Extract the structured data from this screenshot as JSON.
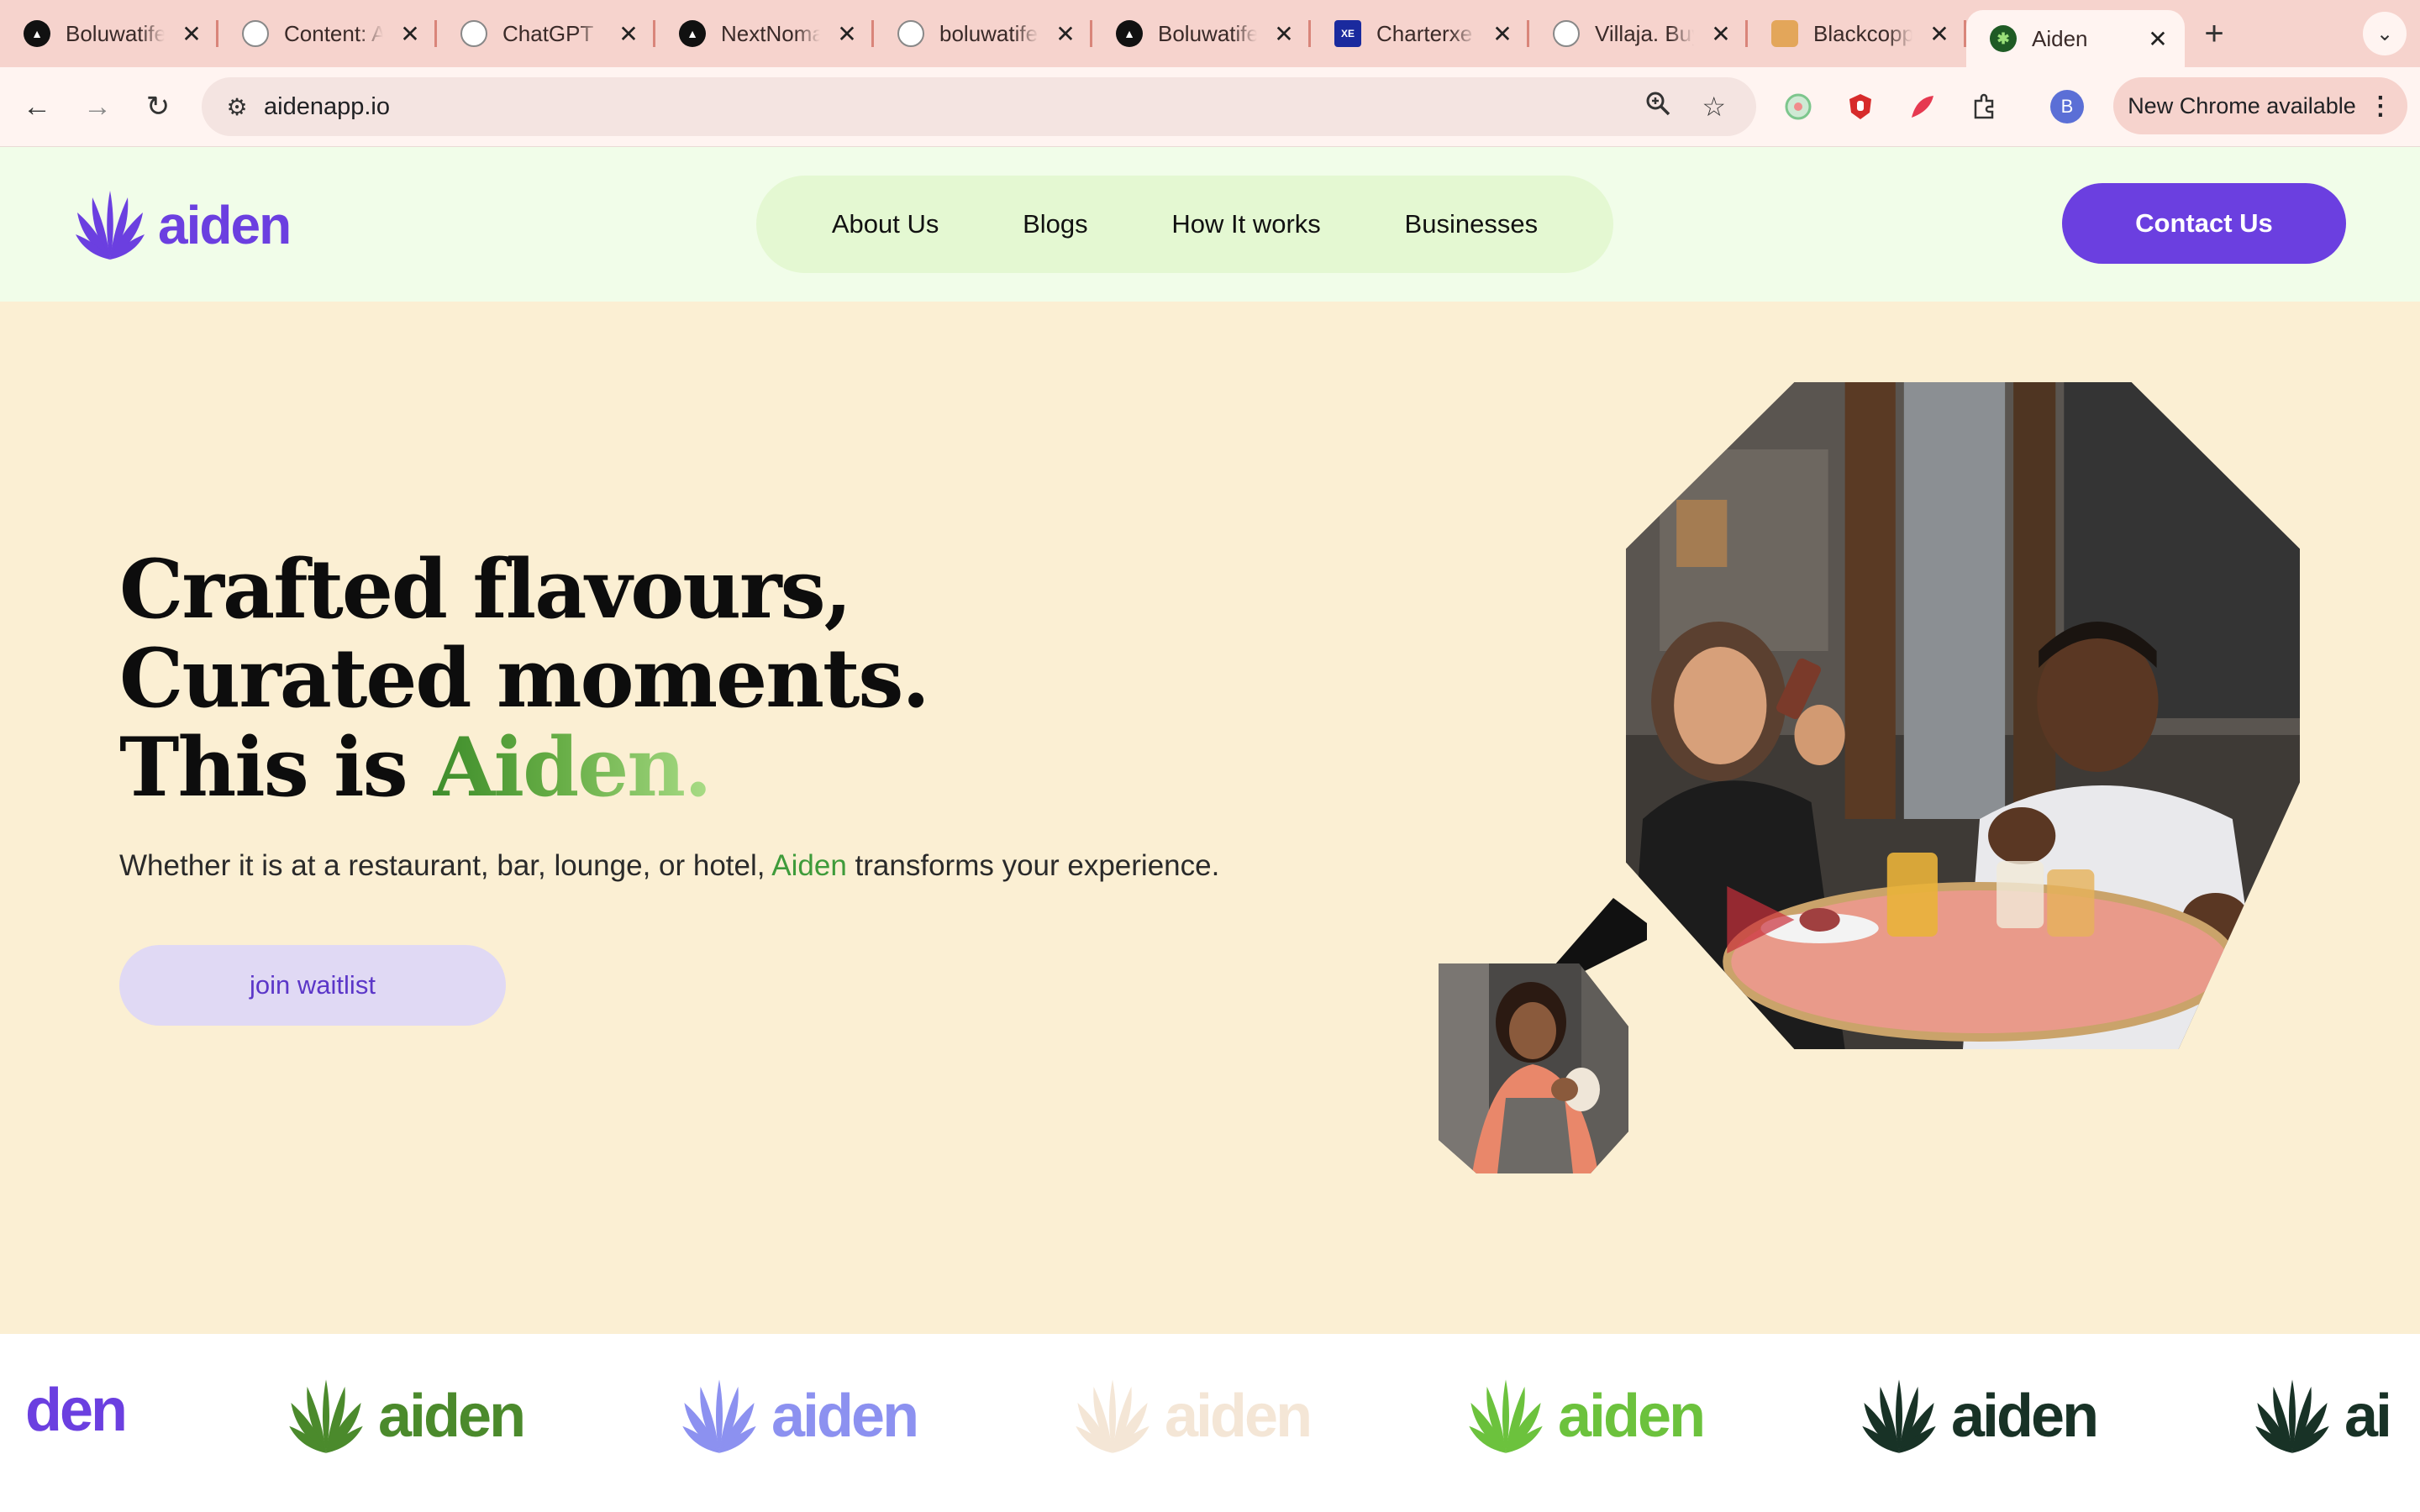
{
  "browser": {
    "tabs": [
      {
        "title": "Boluwatife",
        "favicon": "triangle-logo",
        "color": "#111111"
      },
      {
        "title": "Content: A",
        "favicon": "google-logo",
        "color": "#ffffff"
      },
      {
        "title": "ChatGPT",
        "favicon": "chatgpt-logo",
        "color": "#ffffff"
      },
      {
        "title": "NextNoma",
        "favicon": "triangle-logo",
        "color": "#111111"
      },
      {
        "title": "boluwatife",
        "favicon": "github-logo",
        "color": "#ffffff"
      },
      {
        "title": "Boluwatife",
        "favicon": "triangle-logo",
        "color": "#111111"
      },
      {
        "title": "Charterxe",
        "favicon": "xe-logo",
        "color": "#1a2a9e"
      },
      {
        "title": "Villaja. Buy",
        "favicon": "villaja-logo",
        "color": "#ffffff"
      },
      {
        "title": "Blackcopp",
        "favicon": "blackcopper-logo",
        "color": "#e3a65a"
      },
      {
        "title": "Aiden",
        "favicon": "aiden-leaf-logo",
        "color": "#1f5b25"
      }
    ],
    "url": "aidenapp.io",
    "update_label": "New Chrome available",
    "profile_initial": "B"
  },
  "header": {
    "logo_text": "aiden",
    "nav": [
      "About Us",
      "Blogs",
      "How It works",
      "Businesses"
    ],
    "contact_label": "Contact Us",
    "brand_color": "#6b3fe0"
  },
  "hero": {
    "headline_line1": "Crafted flavours, Curated moments.",
    "headline_prefix": "This is ",
    "headline_brand": "Aiden.",
    "sub_before": "Whether it is at a restaurant, bar, lounge, or hotel, ",
    "sub_brand": "Aiden",
    "sub_after": " transforms your experience.",
    "cta_label": "join waitlist"
  },
  "brand_strip": {
    "items": [
      {
        "text": "den",
        "color": "#6b3fe0"
      },
      {
        "text": "aiden",
        "color": "#4b8a2c"
      },
      {
        "text": "aiden",
        "color": "#8c91f0"
      },
      {
        "text": "aiden",
        "color": "#f4e6d6"
      },
      {
        "text": "aiden",
        "color": "#6cc23d"
      },
      {
        "text": "aiden",
        "color": "#183226"
      },
      {
        "text": "ai",
        "color": "#183226"
      }
    ]
  }
}
